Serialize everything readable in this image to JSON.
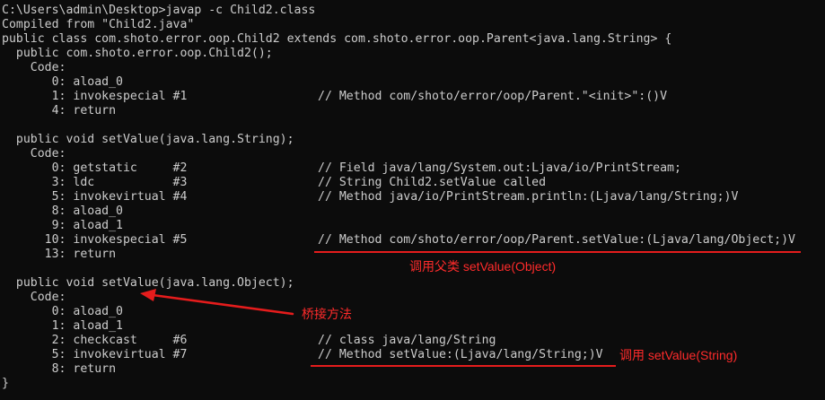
{
  "terminal": {
    "lines": [
      "C:\\Users\\admin\\Desktop>javap -c Child2.class",
      "Compiled from \"Child2.java\"",
      "public class com.shoto.error.oop.Child2 extends com.shoto.error.oop.Parent<java.lang.String> {",
      "  public com.shoto.error.oop.Child2();",
      "    Code:",
      "       0: aload_0",
      "       1: invokespecial #1",
      "       4: return",
      "",
      "  public void setValue(java.lang.String);",
      "    Code:",
      "       0: getstatic     #2",
      "       3: ldc           #3",
      "       5: invokevirtual #4",
      "       8: aload_0",
      "       9: aload_1",
      "      10: invokespecial #5",
      "      13: return",
      "",
      "",
      "  public void setValue(java.lang.Object);",
      "    Code:",
      "       0: aload_0",
      "       1: aload_1",
      "       2: checkcast     #6",
      "       5: invokevirtual #7",
      "       8: return",
      "}"
    ],
    "comments": {
      "c1": "// Method com/shoto/error/oop/Parent.\"<init>\":()V",
      "c2": "// Field java/lang/System.out:Ljava/io/PrintStream;",
      "c3": "// String Child2.setValue called",
      "c4": "// Method java/io/PrintStream.println:(Ljava/lang/String;)V",
      "c5": "// Method com/shoto/error/oop/Parent.setValue:(Ljava/lang/Object;)V",
      "c6": "// class java/lang/String",
      "c7": "// Method setValue:(Ljava/lang/String;)V"
    }
  },
  "annotations": {
    "call_parent": "调用父类 setValue(Object)",
    "bridge_method": "桥接方法",
    "call_string": "调用 setValue(String)"
  },
  "colors": {
    "background": "#0c0c0c",
    "text": "#cccccc",
    "annotation": "#ff2b2b"
  }
}
